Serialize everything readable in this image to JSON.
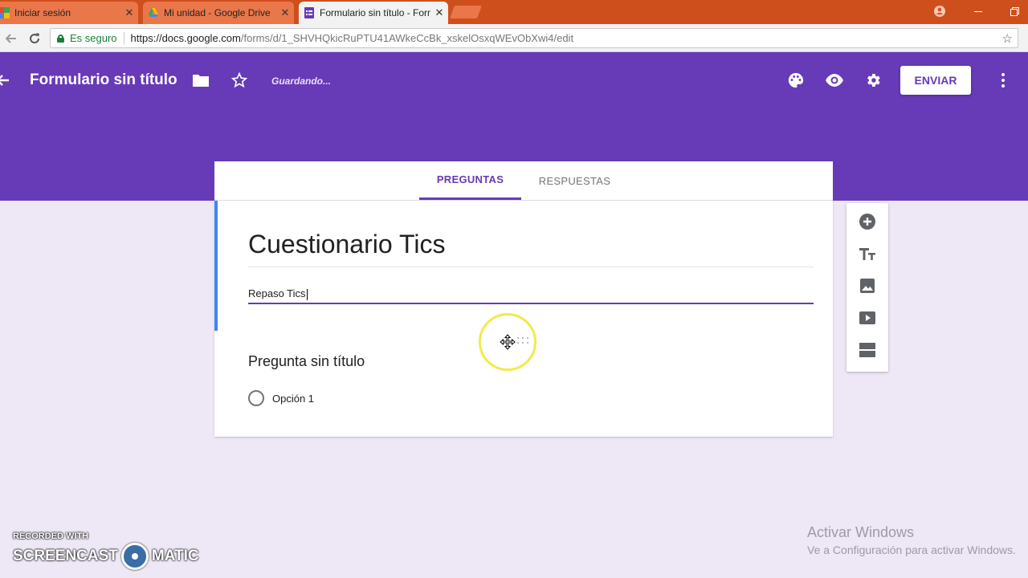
{
  "browser": {
    "tabs": [
      {
        "title": "Iniciar sesión",
        "favicon": "google-multicolor-icon"
      },
      {
        "title": "Mi unidad - Google Drive",
        "favicon": "google-drive-icon"
      },
      {
        "title": "Formulario sin título - Formularios de Google",
        "favicon": "google-forms-icon",
        "active": true
      }
    ],
    "secure_label": "Es seguro",
    "url_host": "https://docs.google.com",
    "url_path": "/forms/d/1_SHVHQkicRuPTU41AWkeCcBk_xskelOsxqWEvObXwi4/edit"
  },
  "header": {
    "title": "Formulario sin título",
    "status": "Guardando...",
    "send_label": "ENVIAR",
    "accent_color": "#673ab7"
  },
  "form_tabs": {
    "questions": "PREGUNTAS",
    "responses": "RESPUESTAS"
  },
  "form": {
    "title": "Cuestionario Tics",
    "description": "Repaso Tics",
    "question_title": "Pregunta sin título",
    "option_1": "Opción 1"
  },
  "side_toolbar": {
    "items": [
      "add-question-icon",
      "add-title-icon",
      "add-image-icon",
      "add-video-icon",
      "add-section-icon"
    ]
  },
  "watermarks": {
    "recorded_with": "RECORDED WITH",
    "brand_left": "SCREENCAST",
    "brand_right": "MATIC",
    "activate_title": "Activar Windows",
    "activate_sub": "Ve a Configuración para activar Windows."
  }
}
